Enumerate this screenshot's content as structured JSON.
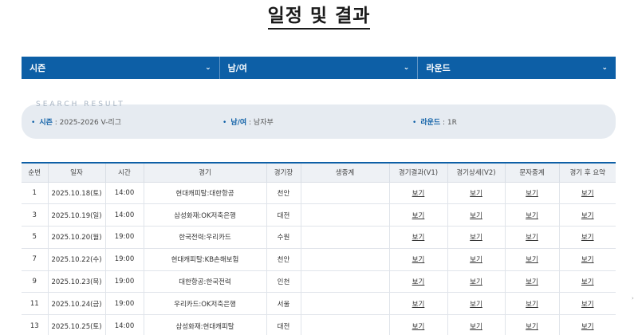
{
  "page": {
    "title": "일정 및 결과"
  },
  "filters": [
    {
      "label": "시즌"
    },
    {
      "label": "남/여"
    },
    {
      "label": "라운드"
    }
  ],
  "search_result": {
    "heading": "SEARCH RESULT",
    "items": [
      {
        "key": "시즌",
        "value": " : 2025-2026 V-리그"
      },
      {
        "key": "남/여",
        "value": " : 남자부"
      },
      {
        "key": "라운드",
        "value": " : 1R"
      }
    ]
  },
  "table": {
    "headers": [
      "순번",
      "일자",
      "시간",
      "경기",
      "경기장",
      "생중계",
      "경기결과(V1)",
      "경기상세(V2)",
      "문자중계",
      "경기 후 요약"
    ],
    "link_label": "보기",
    "rows": [
      {
        "no": "1",
        "date": "2025.10.18(토)",
        "time": "14:00",
        "match": "현대캐피탈:대한항공",
        "venue": "천안"
      },
      {
        "no": "3",
        "date": "2025.10.19(일)",
        "time": "14:00",
        "match": "삼성화재:OK저축은행",
        "venue": "대전"
      },
      {
        "no": "5",
        "date": "2025.10.20(월)",
        "time": "19:00",
        "match": "한국전력:우리카드",
        "venue": "수원"
      },
      {
        "no": "7",
        "date": "2025.10.22(수)",
        "time": "19:00",
        "match": "현대캐피탈:KB손해보험",
        "venue": "천안"
      },
      {
        "no": "9",
        "date": "2025.10.23(목)",
        "time": "19:00",
        "match": "대한항공:한국전력",
        "venue": "인천"
      },
      {
        "no": "11",
        "date": "2025.10.24(금)",
        "time": "19:00",
        "match": "우리카드:OK저축은행",
        "venue": "서울"
      },
      {
        "no": "13",
        "date": "2025.10.25(토)",
        "time": "14:00",
        "match": "삼성화재:현대캐피탈",
        "venue": "대전"
      }
    ]
  }
}
